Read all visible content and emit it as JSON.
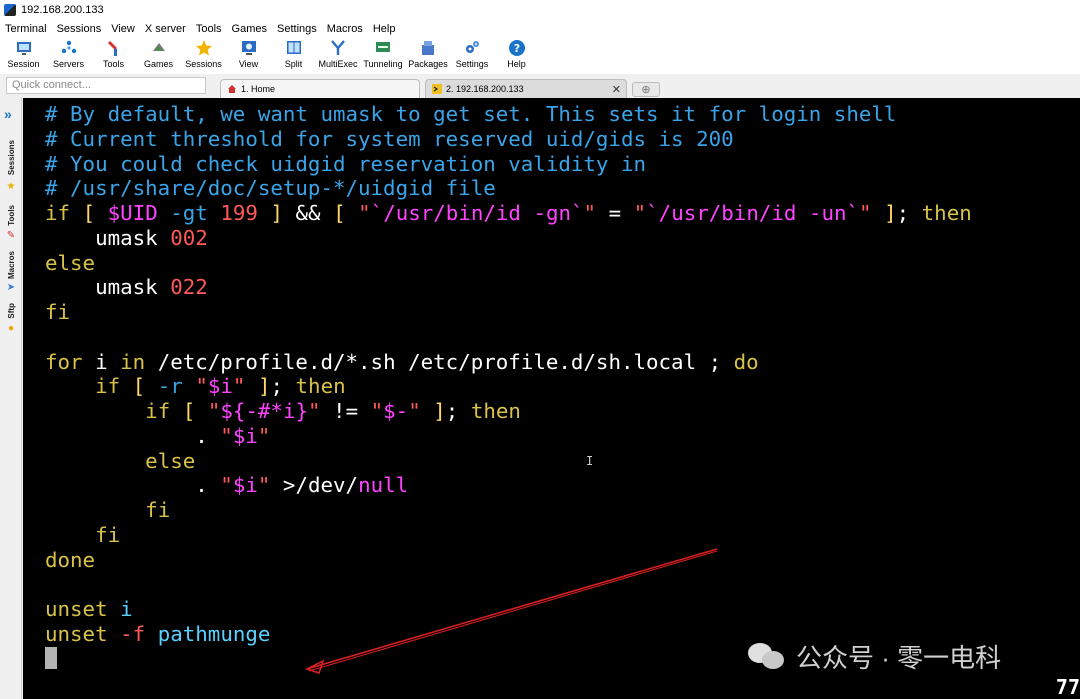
{
  "window": {
    "title": "192.168.200.133"
  },
  "menu": [
    "Terminal",
    "Sessions",
    "View",
    "X server",
    "Tools",
    "Games",
    "Settings",
    "Macros",
    "Help"
  ],
  "toolbar": [
    {
      "label": "Session",
      "icon": "session-icon"
    },
    {
      "label": "Servers",
      "icon": "servers-icon"
    },
    {
      "label": "Tools",
      "icon": "tools-icon"
    },
    {
      "label": "Games",
      "icon": "games-icon"
    },
    {
      "label": "Sessions",
      "icon": "star-icon"
    },
    {
      "label": "View",
      "icon": "view-icon"
    },
    {
      "label": "Split",
      "icon": "split-icon"
    },
    {
      "label": "MultiExec",
      "icon": "multiexec-icon"
    },
    {
      "label": "Tunneling",
      "icon": "tunneling-icon"
    },
    {
      "label": "Packages",
      "icon": "packages-icon"
    },
    {
      "label": "Settings",
      "icon": "gear-icon"
    },
    {
      "label": "Help",
      "icon": "help-icon"
    }
  ],
  "quick_connect": {
    "placeholder": "Quick connect..."
  },
  "tabs": [
    {
      "label": "1. Home",
      "icon": "home-icon"
    },
    {
      "label": "2. 192.168.200.133",
      "icon": "terminal-icon",
      "active": true
    }
  ],
  "side_tabs": [
    "Sessions",
    "Tools",
    "Macros",
    "Sftp"
  ],
  "terminal": {
    "lines": [
      [
        [
          "c",
          "# By default, we want umask to get set. This sets it for login shell"
        ]
      ],
      [
        [
          "c",
          "# Current threshold for system reserved uid/gids is 200"
        ]
      ],
      [
        [
          "c",
          "# You could check uidgid reservation validity in"
        ]
      ],
      [
        [
          "c",
          "# /usr/share/doc/setup-*/uidgid file"
        ]
      ],
      [
        [
          "k",
          "if"
        ],
        [
          "t",
          " "
        ],
        [
          "p",
          "["
        ],
        [
          "t",
          " "
        ],
        [
          "v",
          "$UID"
        ],
        [
          "t",
          " "
        ],
        [
          "c",
          "-gt"
        ],
        [
          "t",
          " "
        ],
        [
          "s",
          "199"
        ],
        [
          "t",
          " "
        ],
        [
          "p",
          "]"
        ],
        [
          "t",
          " && "
        ],
        [
          "p",
          "["
        ],
        [
          "t",
          " "
        ],
        [
          "s",
          "\""
        ],
        [
          "v",
          "`/usr/bin/id -gn`"
        ],
        [
          "s",
          "\""
        ],
        [
          "t",
          " = "
        ],
        [
          "s",
          "\""
        ],
        [
          "v",
          "`/usr/bin/id -un`"
        ],
        [
          "s",
          "\""
        ],
        [
          "t",
          " "
        ],
        [
          "p",
          "]"
        ],
        [
          "t",
          "; "
        ],
        [
          "k",
          "then"
        ]
      ],
      [
        [
          "t",
          "    umask "
        ],
        [
          "s",
          "002"
        ]
      ],
      [
        [
          "k",
          "else"
        ]
      ],
      [
        [
          "t",
          "    umask "
        ],
        [
          "s",
          "022"
        ]
      ],
      [
        [
          "k",
          "fi"
        ]
      ],
      [
        [
          "t",
          ""
        ]
      ],
      [
        [
          "k",
          "for"
        ],
        [
          "t",
          " i "
        ],
        [
          "k",
          "in"
        ],
        [
          "t",
          " /etc/profile.d/*.sh /etc/profile.d/sh.local ; "
        ],
        [
          "k",
          "do"
        ]
      ],
      [
        [
          "t",
          "    "
        ],
        [
          "k",
          "if"
        ],
        [
          "t",
          " "
        ],
        [
          "p",
          "["
        ],
        [
          "t",
          " "
        ],
        [
          "c",
          "-r"
        ],
        [
          "t",
          " "
        ],
        [
          "s",
          "\""
        ],
        [
          "v",
          "$i"
        ],
        [
          "s",
          "\""
        ],
        [
          "t",
          " "
        ],
        [
          "p",
          "]"
        ],
        [
          "t",
          "; "
        ],
        [
          "k",
          "then"
        ]
      ],
      [
        [
          "t",
          "        "
        ],
        [
          "k",
          "if"
        ],
        [
          "t",
          " "
        ],
        [
          "p",
          "["
        ],
        [
          "t",
          " "
        ],
        [
          "s",
          "\""
        ],
        [
          "v",
          "${-#*i}"
        ],
        [
          "s",
          "\""
        ],
        [
          "t",
          " != "
        ],
        [
          "s",
          "\""
        ],
        [
          "v",
          "$-"
        ],
        [
          "s",
          "\""
        ],
        [
          "t",
          " "
        ],
        [
          "p",
          "]"
        ],
        [
          "t",
          "; "
        ],
        [
          "k",
          "then"
        ]
      ],
      [
        [
          "t",
          "            . "
        ],
        [
          "s",
          "\""
        ],
        [
          "v",
          "$i"
        ],
        [
          "s",
          "\""
        ]
      ],
      [
        [
          "t",
          "        "
        ],
        [
          "k",
          "else"
        ]
      ],
      [
        [
          "t",
          "            . "
        ],
        [
          "s",
          "\""
        ],
        [
          "v",
          "$i"
        ],
        [
          "s",
          "\""
        ],
        [
          "t",
          " >/dev/"
        ],
        [
          "v",
          "null"
        ]
      ],
      [
        [
          "t",
          "        "
        ],
        [
          "k",
          "fi"
        ]
      ],
      [
        [
          "t",
          "    "
        ],
        [
          "k",
          "fi"
        ]
      ],
      [
        [
          "k",
          "done"
        ]
      ],
      [
        [
          "t",
          ""
        ]
      ],
      [
        [
          "k",
          "unset"
        ],
        [
          "t",
          " "
        ],
        [
          "b",
          "i"
        ]
      ],
      [
        [
          "k",
          "unset"
        ],
        [
          "t",
          " "
        ],
        [
          "s",
          "-f"
        ],
        [
          "t",
          " "
        ],
        [
          "b",
          "pathmunge"
        ]
      ]
    ]
  },
  "watermark": {
    "text": "公众号 · 零一电科"
  },
  "corner_number": "77",
  "colors": {
    "comment": "#3aa4e8",
    "keyword": "#d8c24a",
    "variable": "#ff44ff",
    "string": "#ff5a5a",
    "arrow": "#e02020"
  }
}
